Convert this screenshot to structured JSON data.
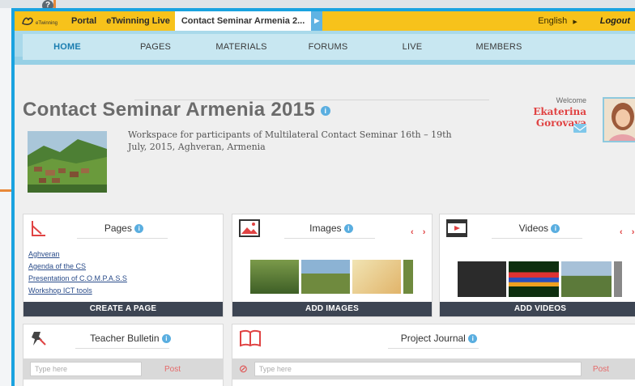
{
  "topbar": {
    "logo_text": "eTwinning",
    "links": [
      "Portal",
      "eTwinning Live"
    ],
    "active_tab": "Contact Seminar Armenia 2...",
    "language": "English",
    "logout": "Logout"
  },
  "nav": {
    "items": [
      "HOME",
      "PAGES",
      "MATERIALS",
      "FORUMS",
      "LIVE",
      "MEMBERS"
    ]
  },
  "header": {
    "title": "Contact Seminar Armenia 2015",
    "description": "Workspace for participants of Multilateral Contact Seminar 16th – 19th July, 2015, Aghveran, Armenia",
    "welcome_label": "Welcome",
    "user_name": "Ekaterina Gorovaya"
  },
  "cards": {
    "pages": {
      "title": "Pages",
      "links": [
        "Aghveran",
        "Agenda of the CS",
        "Presentation of C.O.M.P.A.S.S",
        "Workshop ICT tools"
      ],
      "button": "CREATE A PAGE"
    },
    "images": {
      "title": "Images",
      "button": "ADD IMAGES"
    },
    "videos": {
      "title": "Videos",
      "button": "ADD VIDEOS"
    },
    "bulletin": {
      "title": "Teacher Bulletin",
      "placeholder": "Type here",
      "post": "Post"
    },
    "journal": {
      "title": "Project Journal",
      "placeholder": "Type here",
      "post": "Post"
    }
  },
  "colors": {
    "topbar": "#f7c21b",
    "frame": "#1aa3e0",
    "accent_red": "#e04343",
    "button_dark": "#3d4553"
  }
}
